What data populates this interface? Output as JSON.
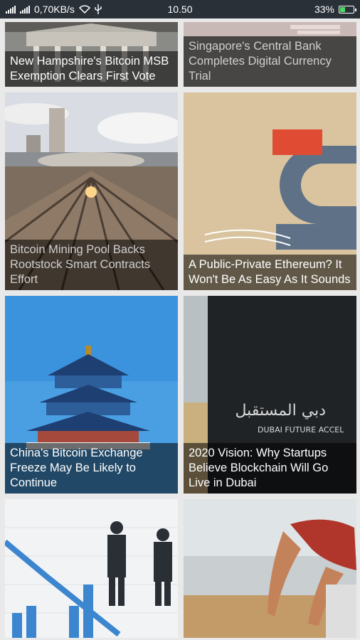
{
  "status_bar": {
    "network_speed": "0,70KB/s",
    "time": "10.50",
    "battery_percent": "33%",
    "battery_level": 0.33
  },
  "articles": [
    {
      "title": "New Hampshire's Bitcoin MSB Exemption Clears First Vote",
      "dimmed": false
    },
    {
      "title": "Singapore's Central Bank Completes Digital Currency Trial",
      "dimmed": true
    },
    {
      "title": "Bitcoin Mining Pool Backs Rootstock Smart Contracts Effort",
      "dimmed": true
    },
    {
      "title": "A Public-Private Ethereum? It Won't Be As Easy As It Sounds",
      "dimmed": false
    },
    {
      "title": "China's Bitcoin Exchange Freeze May Be Likely to Continue",
      "dimmed": false
    },
    {
      "title": "2020 Vision: Why Startups Believe Blockchain Will Go Live in Dubai",
      "dimmed": false
    },
    {
      "title": "",
      "dimmed": false
    },
    {
      "title": "",
      "dimmed": false
    }
  ],
  "image_text": {
    "dubai_arabic": "دبي المستقبل",
    "dubai_english": "DUBAI FUTURE ACCEL"
  }
}
